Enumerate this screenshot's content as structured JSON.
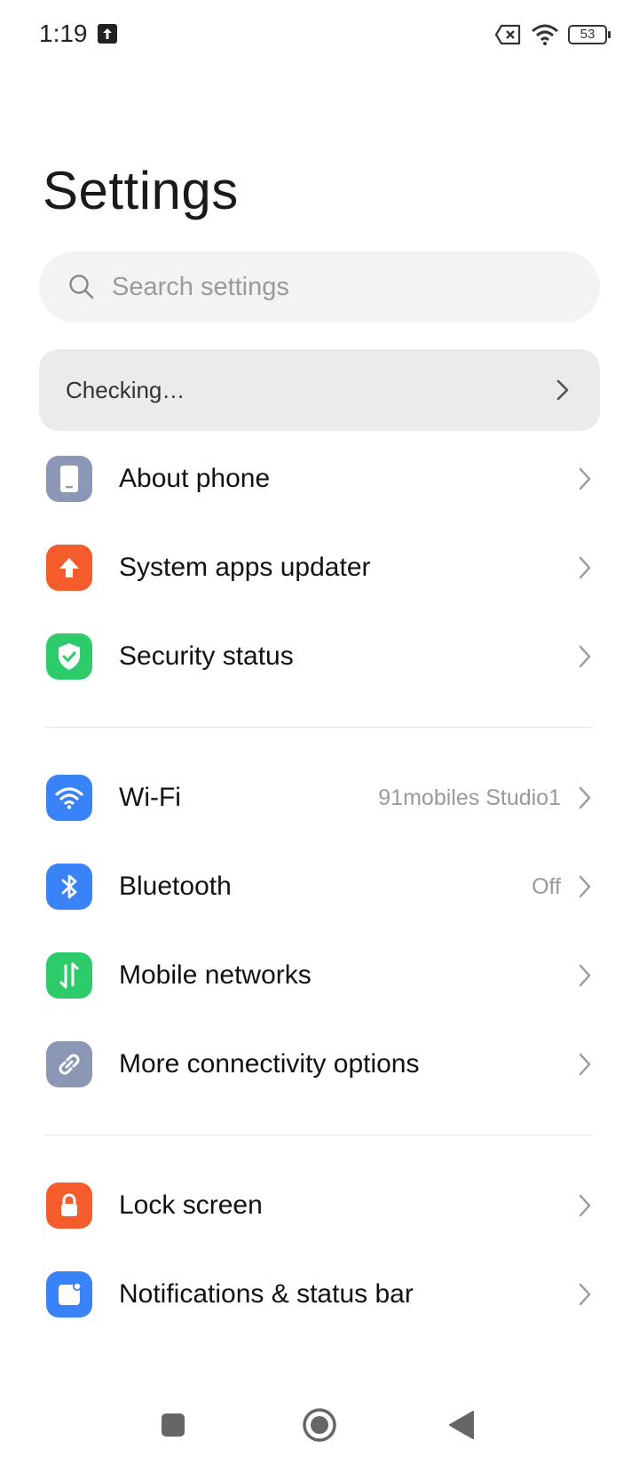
{
  "status_bar": {
    "time": "1:19",
    "battery_level": "53"
  },
  "page": {
    "title": "Settings"
  },
  "search": {
    "placeholder": "Search settings"
  },
  "update_card": {
    "label": "Checking…"
  },
  "section1": {
    "items": [
      {
        "label": "About phone",
        "icon": "phone-icon",
        "color": "#8C96B5"
      },
      {
        "label": "System apps updater",
        "icon": "arrow-up-icon",
        "color": "#F45C2C"
      },
      {
        "label": "Security status",
        "icon": "shield-check-icon",
        "color": "#2DCB6A"
      }
    ]
  },
  "section2": {
    "items": [
      {
        "label": "Wi-Fi",
        "value": "91mobiles Studio1",
        "icon": "wifi-icon",
        "color": "#3A82F7"
      },
      {
        "label": "Bluetooth",
        "value": "Off",
        "icon": "bluetooth-icon",
        "color": "#3A82F7"
      },
      {
        "label": "Mobile networks",
        "icon": "mobile-data-icon",
        "color": "#2DCB6A"
      },
      {
        "label": "More connectivity options",
        "icon": "link-icon",
        "color": "#8C96B5"
      }
    ]
  },
  "section3": {
    "items": [
      {
        "label": "Lock screen",
        "icon": "lock-icon",
        "color": "#F45C2C"
      },
      {
        "label": "Notifications & status bar",
        "icon": "notification-icon",
        "color": "#3A82F7"
      }
    ]
  }
}
